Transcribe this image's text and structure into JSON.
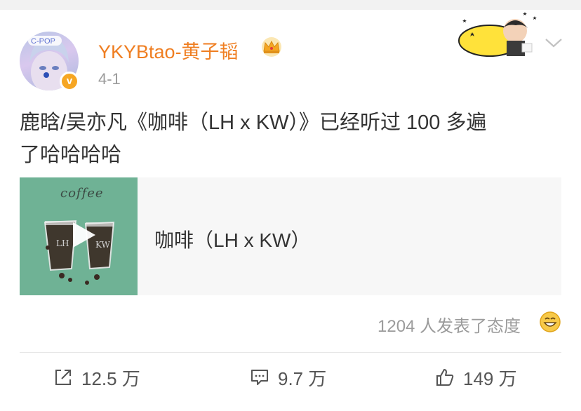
{
  "header": {
    "username": "YKYBtao-黄子韬",
    "date": "4-1"
  },
  "post": {
    "line1": "鹿晗/吴亦凡《咖啡（LH x KW）》已经听过 100 多遍",
    "line2": "了哈哈哈哈"
  },
  "music_card": {
    "cover_text": "coffee",
    "title": "咖啡（LH x KW）"
  },
  "reactions": {
    "text": "1204 人发表了态度"
  },
  "actions": {
    "repost_count": "12.5 万",
    "comment_count": "9.7 万",
    "like_count": "149 万"
  },
  "colors": {
    "username": "#ef7e21",
    "vip_badge": "#f6a623",
    "muted": "#9b9b9b",
    "cover": "#6fb295"
  },
  "icons": [
    "crown-icon",
    "verified-badge-icon",
    "chevron-down-icon",
    "play-icon",
    "smile-emoji-icon",
    "repost-icon",
    "comment-icon",
    "like-icon"
  ]
}
